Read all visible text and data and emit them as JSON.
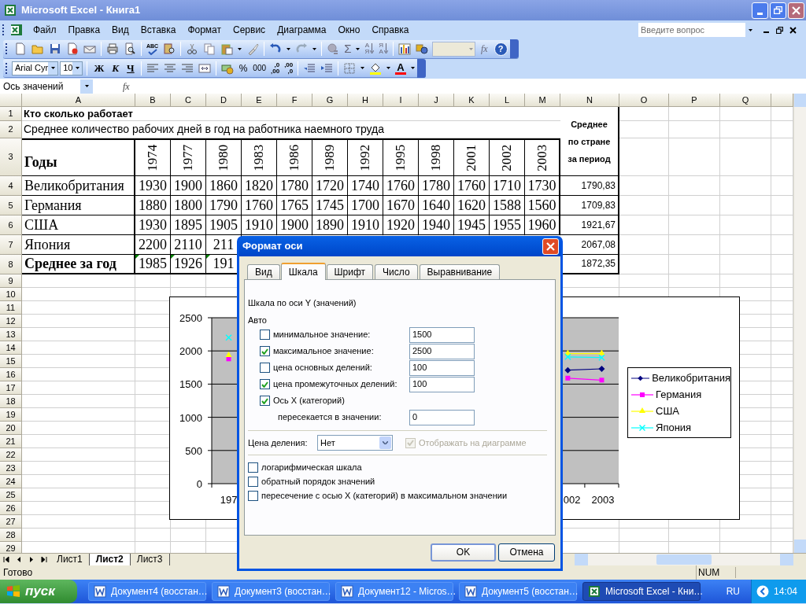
{
  "window": {
    "title": "Microsoft Excel - Книга1"
  },
  "menu": [
    "Файл",
    "Правка",
    "Вид",
    "Вставка",
    "Формат",
    "Сервис",
    "Диаграмма",
    "Окно",
    "Справка"
  ],
  "help_search": {
    "placeholder": "Введите вопрос"
  },
  "standard_toolbar": {
    "spelling": "ABC",
    "autosum": "Σ",
    "sort_ascending": [
      "А",
      "Я"
    ],
    "sort_descending": [
      "Я",
      "А"
    ],
    "fx": "fx",
    "help": "?"
  },
  "format_toolbar": {
    "font": "Arial Cyr",
    "size": "10",
    "bold": "Ж",
    "italic": "К",
    "underline": "Ч",
    "percent": "%",
    "thousands": "000",
    "increase_decimal": [
      ",0",
      ",00"
    ],
    "decrease_decimal": [
      ",00",
      ",0"
    ],
    "font_color": "A"
  },
  "formula_bar": {
    "name_box": "Ось значений",
    "fx": "fx"
  },
  "sheet": {
    "columns": [
      "A",
      "B",
      "C",
      "D",
      "E",
      "F",
      "G",
      "H",
      "I",
      "J",
      "K",
      "L",
      "M",
      "N",
      "O",
      "P",
      "Q"
    ],
    "average_header": "Среднее по стране за период",
    "rows": [
      {
        "number": "1",
        "kind": "title",
        "label": "Кто сколько работает"
      },
      {
        "number": "2",
        "kind": "subtitle",
        "label": "Среднее количество рабочих дней в год на работника наемного труда"
      },
      {
        "number": "3",
        "kind": "header",
        "label": "Годы",
        "values": [
          "1974",
          "1977",
          "1980",
          "1983",
          "1986",
          "1989",
          "1992",
          "1995",
          "1998",
          "2001",
          "2002",
          "2003"
        ]
      },
      {
        "number": "4",
        "kind": "data",
        "label": "Великобритания",
        "flagged": false,
        "values": [
          "1930",
          "1900",
          "1860",
          "1820",
          "1780",
          "1720",
          "1740",
          "1760",
          "1780",
          "1760",
          "1710",
          "1730"
        ],
        "average": "1790,83"
      },
      {
        "number": "5",
        "kind": "data",
        "label": "Германия",
        "flagged": false,
        "values": [
          "1880",
          "1800",
          "1790",
          "1760",
          "1765",
          "1745",
          "1700",
          "1670",
          "1640",
          "1620",
          "1588",
          "1560"
        ],
        "average": "1709,83"
      },
      {
        "number": "6",
        "kind": "data",
        "label": "США",
        "flagged": false,
        "values": [
          "1930",
          "1895",
          "1905",
          "1910",
          "1900",
          "1890",
          "1910",
          "1920",
          "1940",
          "1945",
          "1955",
          "1960"
        ],
        "average": "1921,67"
      },
      {
        "number": "7",
        "kind": "data",
        "label": "Япония",
        "flagged": false,
        "values": [
          "2200",
          "2110",
          "211"
        ],
        "average": "2067,08"
      },
      {
        "number": "8",
        "kind": "total",
        "label": "Среднее за год",
        "flagged": true,
        "values": [
          "1985",
          "1926",
          "191"
        ],
        "average": "1872,35"
      },
      {
        "number": "9",
        "kind": "empty"
      },
      {
        "number": "10",
        "kind": "empty"
      },
      {
        "number": "11",
        "kind": "empty"
      },
      {
        "number": "12",
        "kind": "empty"
      },
      {
        "number": "13",
        "kind": "empty"
      },
      {
        "number": "14",
        "kind": "empty"
      },
      {
        "number": "15",
        "kind": "empty"
      },
      {
        "number": "16",
        "kind": "empty"
      },
      {
        "number": "17",
        "kind": "empty"
      },
      {
        "number": "18",
        "kind": "empty"
      },
      {
        "number": "19",
        "kind": "empty"
      },
      {
        "number": "20",
        "kind": "empty"
      },
      {
        "number": "21",
        "kind": "empty"
      },
      {
        "number": "22",
        "kind": "empty"
      },
      {
        "number": "23",
        "kind": "empty"
      },
      {
        "number": "24",
        "kind": "empty"
      },
      {
        "number": "25",
        "kind": "empty"
      },
      {
        "number": "26",
        "kind": "empty"
      },
      {
        "number": "27",
        "kind": "empty"
      },
      {
        "number": "28",
        "kind": "empty"
      },
      {
        "number": "29",
        "kind": "empty"
      }
    ]
  },
  "chart": {
    "chart_data": {
      "type": "line",
      "categories": [
        "197",
        null,
        null,
        null,
        null,
        null,
        null,
        null,
        null,
        null,
        "002",
        "2003"
      ],
      "ylim": [
        0,
        2500
      ],
      "yticks": [
        0,
        500,
        1000,
        1500,
        2000,
        2500
      ],
      "grid": true,
      "legend": true,
      "series": [
        {
          "name": "Великобритания",
          "color": "#000080",
          "marker": "diamond",
          "values": [
            null,
            null,
            null,
            null,
            null,
            null,
            null,
            null,
            null,
            null,
            1710,
            1730
          ]
        },
        {
          "name": "Германия",
          "color": "#ff00ff",
          "marker": "square",
          "values": [
            1880,
            null,
            null,
            null,
            null,
            null,
            null,
            null,
            null,
            null,
            1590,
            1560
          ]
        },
        {
          "name": "США",
          "color": "#ffff00",
          "marker": "triangle",
          "values": [
            1930,
            null,
            null,
            null,
            null,
            null,
            null,
            null,
            null,
            null,
            1960,
            1960
          ]
        },
        {
          "name": "Япония",
          "color": "#00ffff",
          "marker": "cross",
          "values": [
            2200,
            null,
            null,
            null,
            null,
            null,
            null,
            null,
            null,
            null,
            1910,
            1900
          ]
        }
      ]
    }
  },
  "dialog": {
    "title": "Формат оси",
    "tabs": [
      {
        "label": "Вид",
        "selected": false
      },
      {
        "label": "Шкала",
        "selected": true
      },
      {
        "label": "Шрифт",
        "selected": false
      },
      {
        "label": "Число",
        "selected": false
      },
      {
        "label": "Выравнивание",
        "selected": false
      }
    ],
    "heading": "Шкала по оси Y (значений)",
    "auto_label": "Авто",
    "options": [
      {
        "kind": "auto",
        "label": "минимальное значение:",
        "checked": false,
        "value": "1500"
      },
      {
        "kind": "auto",
        "label": "максимальное значение:",
        "checked": true,
        "value": "2500"
      },
      {
        "kind": "auto",
        "label": "цена основных делений:",
        "checked": false,
        "value": "100"
      },
      {
        "kind": "auto",
        "label": "цена промежуточных делений:",
        "checked": true,
        "value": "100"
      },
      {
        "kind": "auto",
        "label": "Ось X (категорий)",
        "checked": true
      },
      {
        "kind": "crosses",
        "label": "пересекается в значении:",
        "value": "0"
      }
    ],
    "units": {
      "label": "Цена деления:",
      "value": "Нет",
      "show_label": "Отображать на диаграмме",
      "show_checked": true,
      "show_disabled": true
    },
    "flags": [
      {
        "label": "логарифмическая шкала",
        "checked": false
      },
      {
        "label": "обратный порядок значений",
        "checked": false
      },
      {
        "label": "пересечение с осью X (категорий) в максимальном значении",
        "checked": false
      }
    ],
    "buttons": [
      "OK",
      "Отмена"
    ]
  },
  "sheet_tabs": [
    {
      "label": "Лист1",
      "selected": false
    },
    {
      "label": "Лист2",
      "selected": true
    },
    {
      "label": "Лист3",
      "selected": false
    }
  ],
  "status_bar": {
    "text": "Готово",
    "num": "NUM"
  },
  "taskbar": {
    "start": "пуск",
    "items": [
      {
        "kind": "word",
        "label": "Документ4 (восстан…",
        "selected": false
      },
      {
        "kind": "word",
        "label": "Документ3 (восстан…",
        "selected": false
      },
      {
        "kind": "word",
        "label": "Документ12 - Micros…",
        "selected": false
      },
      {
        "kind": "word",
        "label": "Документ5 (восстан…",
        "selected": false
      },
      {
        "kind": "excel",
        "label": "Microsoft Excel - Кни…",
        "selected": true
      }
    ],
    "language": "RU",
    "clock": "14:04"
  }
}
